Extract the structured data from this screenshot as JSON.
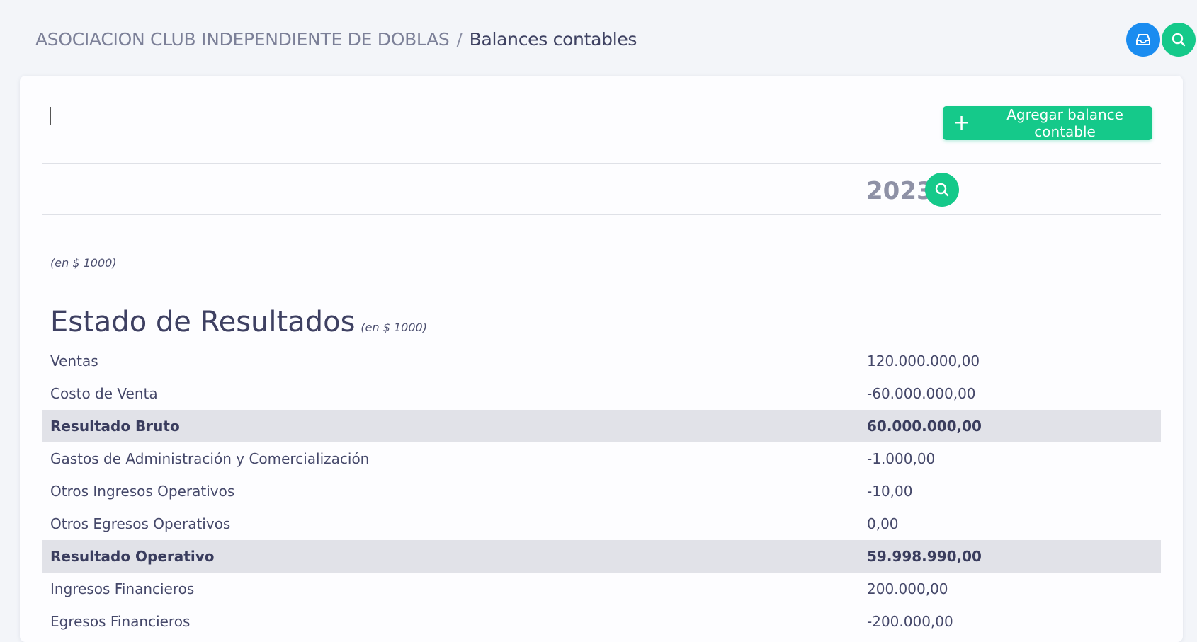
{
  "breadcrumb": {
    "organization": "ASOCIACION CLUB INDEPENDIENTE DE DOBLAS",
    "separator": "/",
    "current": "Balances contables"
  },
  "icons": {
    "inbox": "inbox-icon",
    "search": "search-icon",
    "plus": "plus-icon"
  },
  "colors": {
    "primary_blue": "#1a8cf0",
    "accent_green": "#15c98a",
    "total_row_bg": "#e1e2e8"
  },
  "toolbar": {
    "add_label": "Agregar balance contable"
  },
  "year": "2023",
  "unit_note": "(en $ 1000)",
  "section": {
    "title": "Estado de Resultados",
    "unit": "(en $ 1000)"
  },
  "rows": [
    {
      "label": "Ventas",
      "value": "120.000.000,00",
      "total": false
    },
    {
      "label": "Costo de Venta",
      "value": "-60.000.000,00",
      "total": false
    },
    {
      "label": "Resultado Bruto",
      "value": "60.000.000,00",
      "total": true
    },
    {
      "label": "Gastos de Administración y Comercialización",
      "value": "-1.000,00",
      "total": false
    },
    {
      "label": "Otros Ingresos Operativos",
      "value": "-10,00",
      "total": false
    },
    {
      "label": "Otros Egresos Operativos",
      "value": "0,00",
      "total": false
    },
    {
      "label": "Resultado Operativo",
      "value": "59.998.990,00",
      "total": true
    },
    {
      "label": "Ingresos Financieros",
      "value": "200.000,00",
      "total": false
    },
    {
      "label": "Egresos Financieros",
      "value": "-200.000,00",
      "total": false
    }
  ]
}
